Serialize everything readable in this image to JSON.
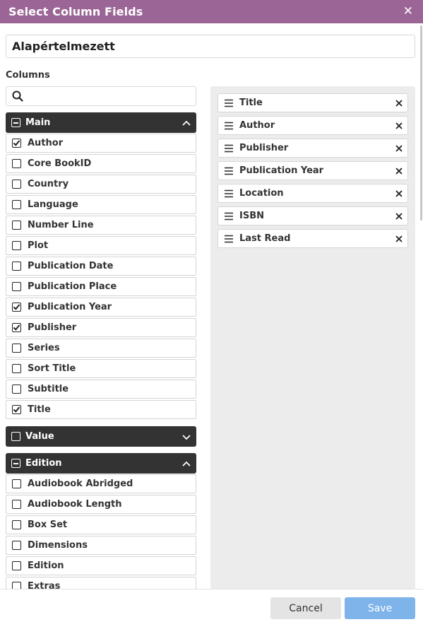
{
  "dialog": {
    "title": "Select Column Fields",
    "close_icon": "close-icon",
    "header_color": "#9b6696"
  },
  "preset_name": "Alapértelmezett",
  "columns_label": "Columns",
  "search": {
    "placeholder": "",
    "icon": "search-icon"
  },
  "groups": {
    "main": {
      "label": "Main",
      "expanded": true,
      "items": [
        {
          "label": "Author",
          "checked": true
        },
        {
          "label": "Core BookID",
          "checked": false
        },
        {
          "label": "Country",
          "checked": false
        },
        {
          "label": "Language",
          "checked": false
        },
        {
          "label": "Number Line",
          "checked": false
        },
        {
          "label": "Plot",
          "checked": false
        },
        {
          "label": "Publication Date",
          "checked": false
        },
        {
          "label": "Publication Place",
          "checked": false
        },
        {
          "label": "Publication Year",
          "checked": true
        },
        {
          "label": "Publisher",
          "checked": true
        },
        {
          "label": "Series",
          "checked": false
        },
        {
          "label": "Sort Title",
          "checked": false
        },
        {
          "label": "Subtitle",
          "checked": false
        },
        {
          "label": "Title",
          "checked": true
        }
      ]
    },
    "value": {
      "label": "Value",
      "expanded": false,
      "items": []
    },
    "edition": {
      "label": "Edition",
      "expanded": true,
      "items": [
        {
          "label": "Audiobook Abridged",
          "checked": false
        },
        {
          "label": "Audiobook Length",
          "checked": false
        },
        {
          "label": "Box Set",
          "checked": false
        },
        {
          "label": "Dimensions",
          "checked": false
        },
        {
          "label": "Edition",
          "checked": false
        },
        {
          "label": "Extras",
          "checked": false
        }
      ]
    }
  },
  "selected_columns": [
    "Title",
    "Author",
    "Publisher",
    "Publication Year",
    "Location",
    "ISBN",
    "Last Read"
  ],
  "footer": {
    "cancel_label": "Cancel",
    "save_label": "Save",
    "save_color": "#7eb4ea"
  }
}
